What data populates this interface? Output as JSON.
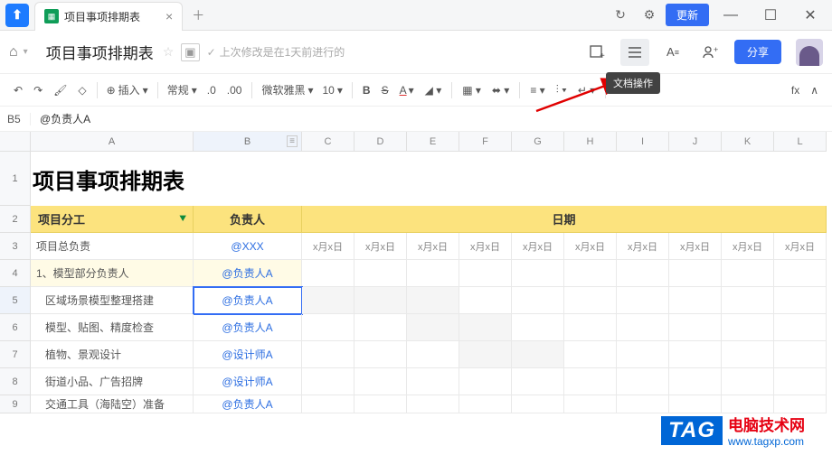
{
  "titlebar": {
    "tab": "项目事项排期表",
    "update": "更新"
  },
  "header": {
    "title": "项目事项排期表",
    "last_edit": "上次修改是在1天前进行的",
    "share": "分享",
    "tooltip": "文档操作"
  },
  "toolbar": {
    "insert": "插入",
    "style": "常规",
    "font": "微软雅黑",
    "size": "10"
  },
  "cellref": {
    "name": "B5",
    "value": "@负责人A"
  },
  "cols": [
    "A",
    "B",
    "C",
    "D",
    "E",
    "F",
    "G",
    "H",
    "I",
    "J",
    "K",
    "L"
  ],
  "rows": [
    "1",
    "2",
    "3",
    "4",
    "5",
    "6",
    "7",
    "8",
    "9"
  ],
  "chart_data": {
    "type": "table",
    "title": "项目事项排期表",
    "columns": {
      "task": "项目分工",
      "owner": "负责人",
      "dates_header": "日期"
    },
    "date_placeholder": "x月x日",
    "rows": [
      {
        "task": "项目总负责",
        "owner": "@XXX",
        "style": "white",
        "dates": 10
      },
      {
        "task": "1、模型部分负责人",
        "owner": "@负责人A",
        "style": "lightyellow"
      },
      {
        "task": "区域场景模型整理搭建",
        "owner": "@负责人A",
        "style": "selected",
        "shaded": [
          0,
          1,
          2
        ]
      },
      {
        "task": "模型、贴图、精度检查",
        "owner": "@负责人A",
        "shaded": [
          2,
          3
        ]
      },
      {
        "task": "植物、景观设计",
        "owner": "@设计师A",
        "shaded": [
          3,
          4
        ]
      },
      {
        "task": "街道小品、广告招牌",
        "owner": "@设计师A",
        "shaded": []
      },
      {
        "task": "交通工具（海陆空）准备",
        "owner": "@负责人A"
      }
    ]
  },
  "watermark": {
    "tag": "TAG",
    "cn": "电脑技术网",
    "url": "www.tagxp.com"
  }
}
